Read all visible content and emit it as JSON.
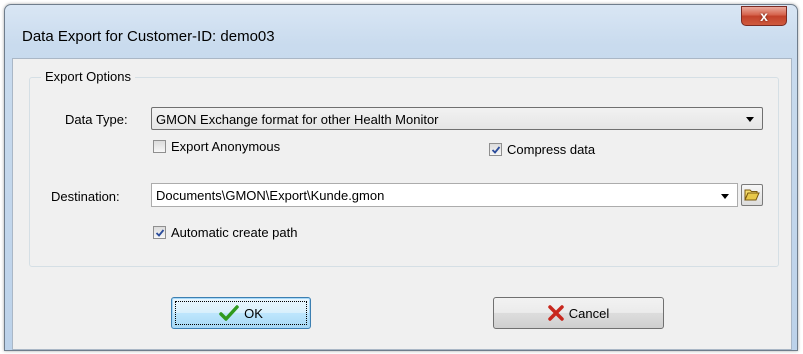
{
  "window": {
    "title": "Data Export for Customer-ID: demo03",
    "close_glyph": "x"
  },
  "export_options": {
    "group_title": "Export Options",
    "data_type": {
      "label": "Data Type:",
      "selected": "GMON Exchange format for other Health Monitor"
    },
    "export_anonymous": {
      "label": "Export Anonymous",
      "checked": false
    },
    "compress_data": {
      "label": "Compress data",
      "checked": true
    },
    "destination": {
      "label": "Destination:",
      "value": "Documents\\GMON\\Export\\Kunde.gmon"
    },
    "automatic_create_path": {
      "label": "Automatic create path",
      "checked": true
    }
  },
  "buttons": {
    "ok_label": "OK",
    "cancel_label": "Cancel"
  },
  "icons": {
    "close": "close-icon",
    "dropdown": "chevron-down-icon",
    "browse": "folder-open-icon",
    "ok": "checkmark-icon",
    "cancel": "x-mark-icon"
  },
  "colors": {
    "ok_icon": "#2f9a1e",
    "cancel_icon": "#c8281e",
    "folder_icon": "#e8c84a",
    "close_button": "#c2412a"
  }
}
